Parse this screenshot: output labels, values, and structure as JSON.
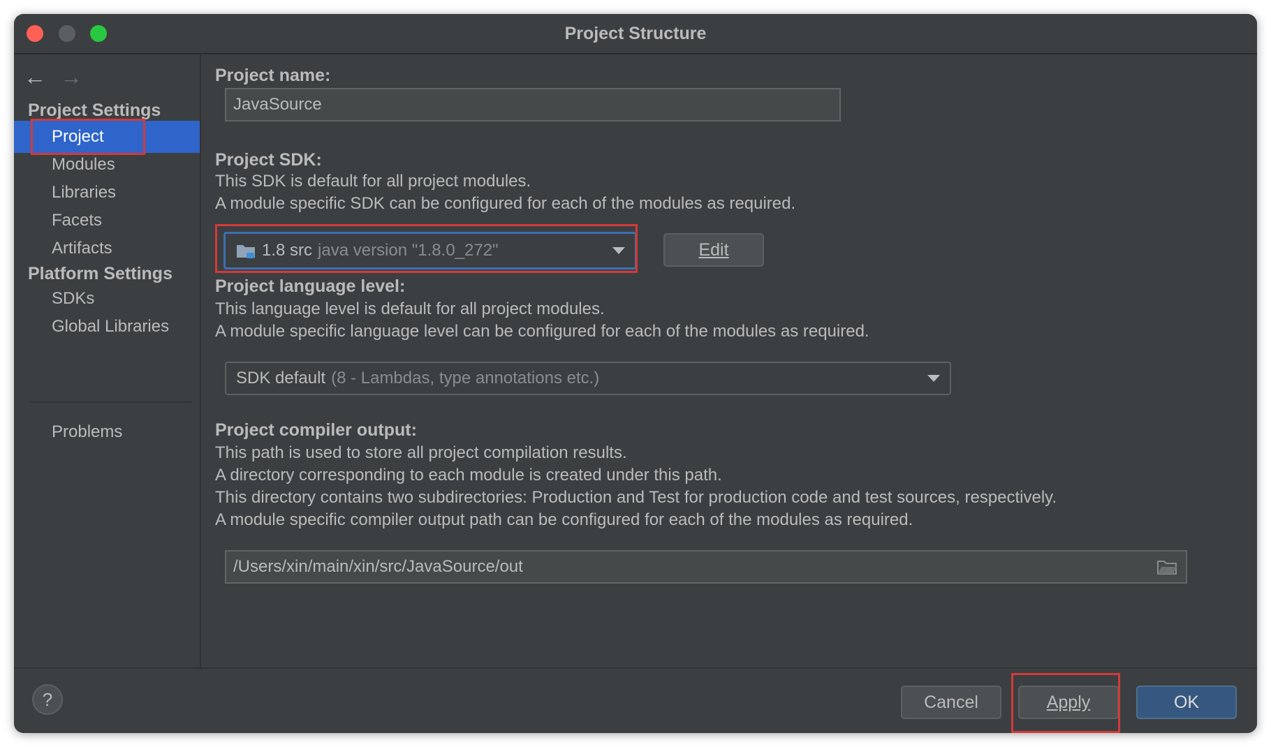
{
  "window": {
    "title": "Project Structure"
  },
  "sidebar": {
    "project_settings_title": "Project Settings",
    "platform_settings_title": "Platform Settings",
    "items": [
      {
        "label": "Project"
      },
      {
        "label": "Modules"
      },
      {
        "label": "Libraries"
      },
      {
        "label": "Facets"
      },
      {
        "label": "Artifacts"
      },
      {
        "label": "SDKs"
      },
      {
        "label": "Global Libraries"
      },
      {
        "label": "Problems"
      }
    ]
  },
  "project_name": {
    "label": "Project name:",
    "value": "JavaSource"
  },
  "project_sdk": {
    "label": "Project SDK:",
    "desc1": "This SDK is default for all project modules.",
    "desc2": "A module specific SDK can be configured for each of the modules as required.",
    "selected": "1.8 src",
    "selected_detail": "java version \"1.8.0_272\"",
    "edit_label": "Edit"
  },
  "language_level": {
    "label": "Project language level:",
    "desc1": "This language level is default for all project modules.",
    "desc2": "A module specific language level can be configured for each of the modules as required.",
    "selected": "SDK default",
    "selected_detail": "(8 - Lambdas, type annotations etc.)"
  },
  "compiler_output": {
    "label": "Project compiler output:",
    "desc1": "This path is used to store all project compilation results.",
    "desc2": "A directory corresponding to each module is created under this path.",
    "desc3": "This directory contains two subdirectories: Production and Test for production code and test sources, respectively.",
    "desc4": "A module specific compiler output path can be configured for each of the modules as required.",
    "value": "/Users/xin/main/xin/src/JavaSource/out"
  },
  "footer": {
    "help": "?",
    "cancel": "Cancel",
    "apply": "Apply",
    "ok": "OK"
  },
  "colors": {
    "background": "#3c3f41",
    "selection": "#2f65ca",
    "primary_button": "#365880",
    "highlight_box": "#d23a3a"
  }
}
